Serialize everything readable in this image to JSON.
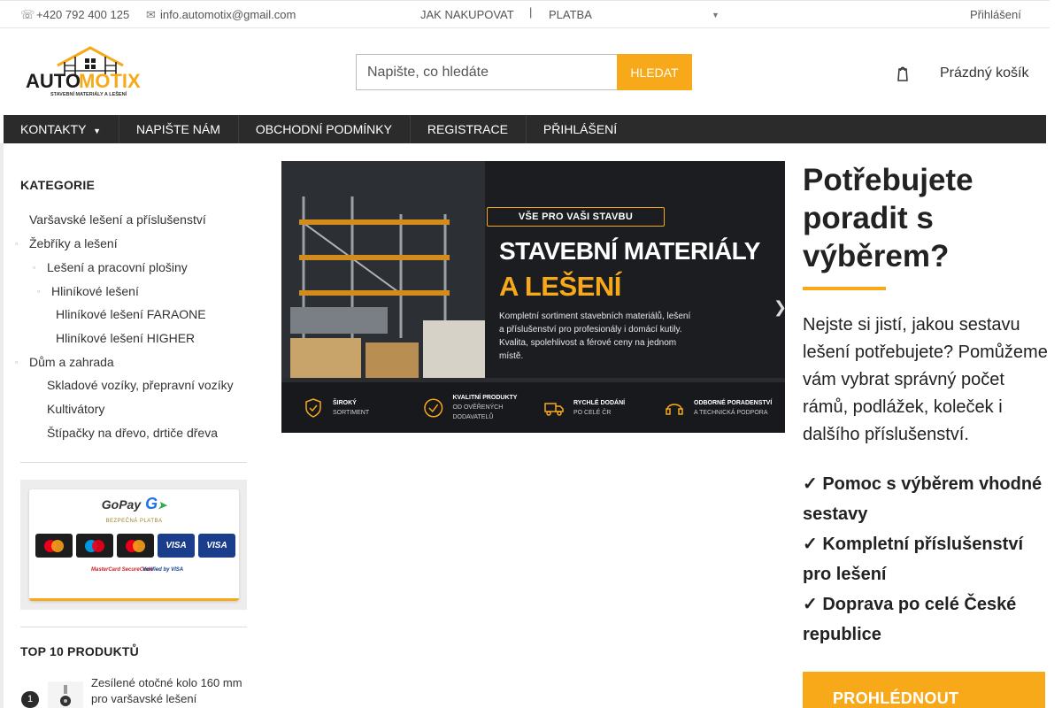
{
  "topbar": {
    "phone": "+420 792 400 125",
    "email": "info.automotix@gmail.com",
    "how_to_buy": "JAK NAKUPOVAT",
    "separator": "|",
    "payment": "PLATBA",
    "login": "Přihlášení"
  },
  "header": {
    "logo_text_auto": "AUTO",
    "logo_text_motix": "MOTIX",
    "logo_subtitle": "STAVEBNÍ MATERIÁLY A LEŠENÍ",
    "search_placeholder": "Napište, co hledáte",
    "search_button": "HLEDAT",
    "cart_label": "Prázdný košík"
  },
  "nav": {
    "items": [
      "KONTAKTY",
      "NAPIŠTE NÁM",
      "OBCHODNÍ PODMÍNKY",
      "REGISTRACE",
      "PŘIHLÁŠENÍ"
    ]
  },
  "sidebar": {
    "categories_title": "KATEGORIE",
    "categories": [
      "Varšavské lešení a příslušenství",
      "Žebříky a lešení",
      "Lešení a pracovní plošiny",
      "Hliníkové lešení",
      "Hliníkové lešení FARAONE",
      "Hliníkové lešení HIGHER",
      "Dům a zahrada",
      "Skladové vozíky, přepravní vozíky",
      "Kultivátory",
      "Štípačky na dřevo, drtiče dřeva"
    ],
    "payment": {
      "gopay": "GoPay",
      "secure": "BEZPEČNÁ PLATBA",
      "cards": [
        "mastercard",
        "maestro",
        "electronic",
        "VISA",
        "VISA"
      ],
      "securecode": "MasterCard SecureCode",
      "verified": "Verified by VISA"
    },
    "top_title": "TOP 10 PRODUKTŮ",
    "top_items": [
      {
        "rank": "1",
        "name": "Zesílené otočné kolo 160 mm pro varšavské lešení"
      }
    ]
  },
  "banner": {
    "pill": "VŠE PRO VAŠI STAVBU",
    "headline1": "STAVEBNÍ MATERIÁLY",
    "headline2": "A LEŠENÍ",
    "paragraph": "Kompletní sortiment stavebních materiálů, lešení a příslušenství pro profesionály i domácí kutily. Kvalita, spolehlivost a férové ceny na jednom místě.",
    "features": [
      {
        "title": "ŠIROKÝ",
        "sub": "SORTIMENT"
      },
      {
        "title": "KVALITNÍ PRODUKTY",
        "sub": "OD OVĚŘENÝCH DODAVATELŮ"
      },
      {
        "title": "RYCHLÉ DODÁNÍ",
        "sub": "PO CELÉ ČR"
      },
      {
        "title": "ODBORNÉ PORADENSTVÍ",
        "sub": "A TECHNICKÁ PODPORA"
      }
    ]
  },
  "advice": {
    "title": "Potřebujete poradit s výběrem?",
    "text": "Nejste si jistí, jakou sestavu lešení potřebujete? Pomůžeme vám vybrat správný počet rámů, podlážek, koleček i dalšího příslušenství.",
    "checks": [
      "✓ Pomoc s výběrem vhodné sestavy",
      "✓ Kompletní příslušenství pro lešení",
      "✓ Doprava po celé České republice"
    ],
    "button": "PROHLÉDNOUT"
  },
  "colors": {
    "accent": "#f7a91a",
    "nav_bg": "#2b2b2b",
    "banner_bg": "#1b1d21"
  }
}
